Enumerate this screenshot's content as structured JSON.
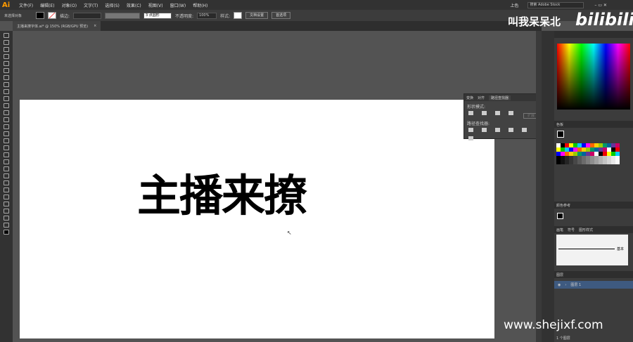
{
  "app": {
    "logo": "Ai",
    "workspace": "上色",
    "search_placeholder": "搜索 Adobe Stock"
  },
  "menu": [
    "文件(F)",
    "编辑(E)",
    "对象(O)",
    "文字(T)",
    "选择(S)",
    "效果(C)",
    "视图(V)",
    "窗口(W)",
    "帮助(H)"
  ],
  "control": {
    "selection": "未选择对象",
    "stroke_label": "描边:",
    "brush": "3 点圆形",
    "opacity_label": "不透明度:",
    "opacity": "100%",
    "style_label": "样式:",
    "doc_setup": "文档设置",
    "prefs": "首选项"
  },
  "document": {
    "tab": "主播来撩字体.ai* @ 150% (RGB/GPU 预览)",
    "artwork_text": "主播来撩"
  },
  "pathfinder": {
    "tabs": [
      "变换",
      "对齐",
      "路径查找器"
    ],
    "shape_modes": "形状模式:",
    "expand": "扩展",
    "pathfinders": "路径查找器:"
  },
  "panels": {
    "swatches": "色板",
    "color_guide": "颜色参考",
    "brushes_tabs": [
      "画笔",
      "符号",
      "图形样式"
    ],
    "brush_basic": "基本",
    "layers": "图层",
    "layer_name": "图层 1",
    "layer_count": "1 个图层"
  },
  "watermark": {
    "author": "叫我呆呆北",
    "site": "bilibili",
    "url": "www.shejixf.com"
  },
  "colors": {
    "accent": "#ff9a00",
    "layer_sel": "#3e5a80"
  }
}
